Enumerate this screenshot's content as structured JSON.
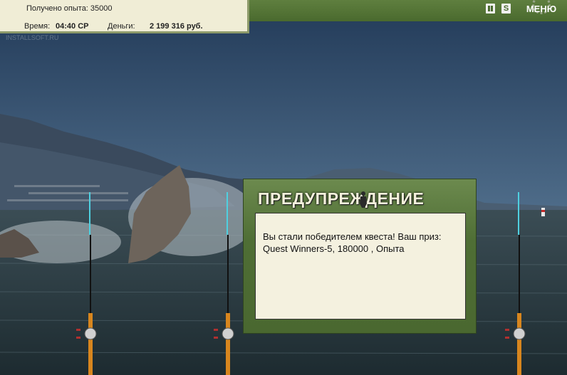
{
  "hud": {
    "experience_text": "Получено опыта: 35000",
    "time_label": "Время:",
    "time_value": "04:40 СР",
    "money_label": "Деньги:",
    "money_value": "2 199 316 руб.",
    "menu_label": "МЕНЮ",
    "sound_label": "S",
    "watermark": "INSTALLSOFT.RU"
  },
  "dialog": {
    "title": "ПРЕДУПРЕЖДЕНИЕ",
    "message_line1": "Вы стали победителем квеста! Ваш приз:",
    "message_line2": "Quest Winners-5, 180000 , Опыта"
  },
  "colors": {
    "topbar": "#4a6a2e",
    "panel": "#f0edd6",
    "dialog_bg": "#5b7a3f",
    "dialog_body": "#f4f1df"
  },
  "icons": [
    "pause-icon",
    "sound-icon",
    "gear-icon",
    "fisherman-icon",
    "fishing-rod",
    "fishing-reel"
  ]
}
